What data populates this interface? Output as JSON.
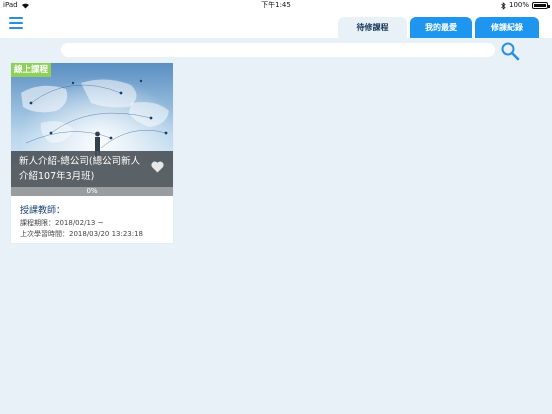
{
  "status_bar": {
    "device": "iPad",
    "time": "下午1:45",
    "battery": "100%"
  },
  "nav": {
    "menu_icon": "hamburger-menu-icon",
    "tabs": [
      {
        "label": "待修課程",
        "active": true
      },
      {
        "label": "我的最愛",
        "active": false
      },
      {
        "label": "修課紀錄",
        "active": false
      }
    ]
  },
  "search": {
    "value": "",
    "placeholder": "",
    "icon": "search-icon"
  },
  "colors": {
    "accent": "#1e96f0",
    "background": "#e8f1f7",
    "badge": "#8fcf5a",
    "progress": "#3db2f0"
  },
  "courses": [
    {
      "badge": "線上課程",
      "title": "新人介紹-總公司(總公司新人介紹107年3月班)",
      "favorite_icon": "heart-icon",
      "progress": 0,
      "progress_label": "0%",
      "teacher_label": "授課教師：",
      "period": "課程期限：2018/02/13 ~",
      "last_study": "上次學習時間：2018/03/20 13:23:18"
    }
  ]
}
